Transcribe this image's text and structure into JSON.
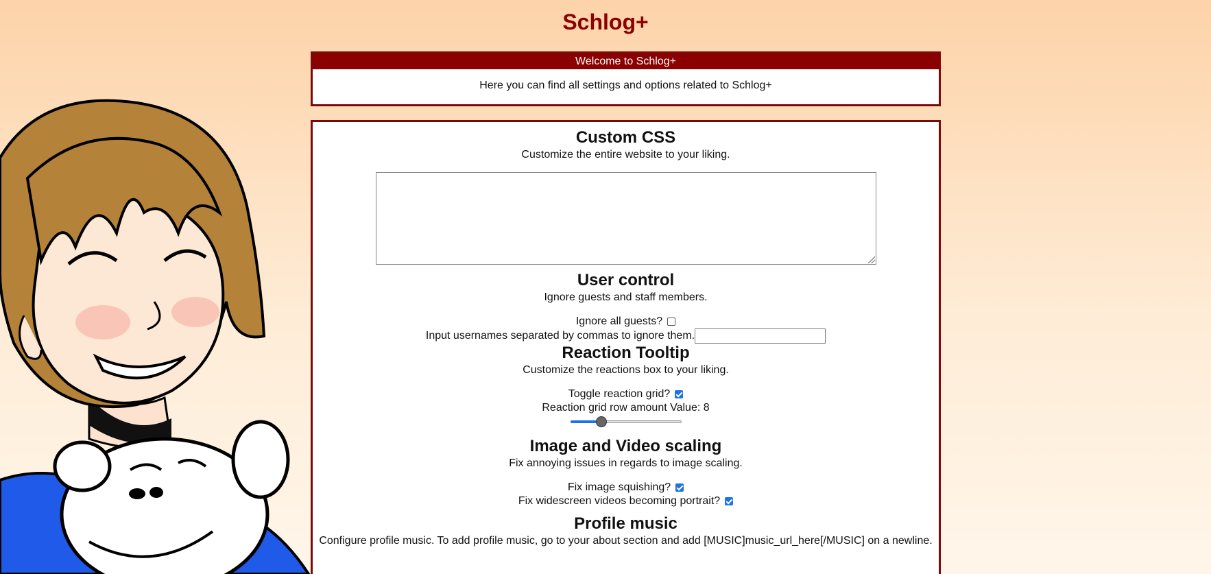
{
  "site": {
    "title": "Schlog+"
  },
  "welcome": {
    "header": "Welcome to Schlog+",
    "body": "Here you can find all settings and options related to Schlog+"
  },
  "custom_css": {
    "title": "Custom CSS",
    "description": "Customize the entire website to your liking.",
    "value": ""
  },
  "user_control": {
    "title": "User control",
    "description": "Ignore guests and staff members.",
    "ignore_guests_label": "Ignore all guests?",
    "ignore_guests_checked": false,
    "ignore_users_label": "Input usernames separated by commas to ignore them.",
    "ignore_users_value": ""
  },
  "reaction_tooltip": {
    "title": "Reaction Tooltip",
    "description": "Customize the reactions box to your liking.",
    "toggle_grid_label": "Toggle reaction grid?",
    "toggle_grid_checked": true,
    "row_amount_label": "Reaction grid row amount Value: 8",
    "row_amount_value": 8,
    "row_amount_fraction": 0.28
  },
  "image_video_scaling": {
    "title": "Image and Video scaling",
    "description": "Fix annoying issues in regards to image scaling.",
    "fix_squishing_label": "Fix image squishing?",
    "fix_squishing_checked": true,
    "fix_widescreen_label": "Fix widescreen videos becoming portrait?",
    "fix_widescreen_checked": true
  },
  "profile_music": {
    "title": "Profile music",
    "description": "Configure profile music. To add profile music, go to your about section and add [MUSIC]music_url_here[/MUSIC] on a newline."
  },
  "colors": {
    "accent": "#8b0000",
    "checkbox": "#1a73e8"
  }
}
